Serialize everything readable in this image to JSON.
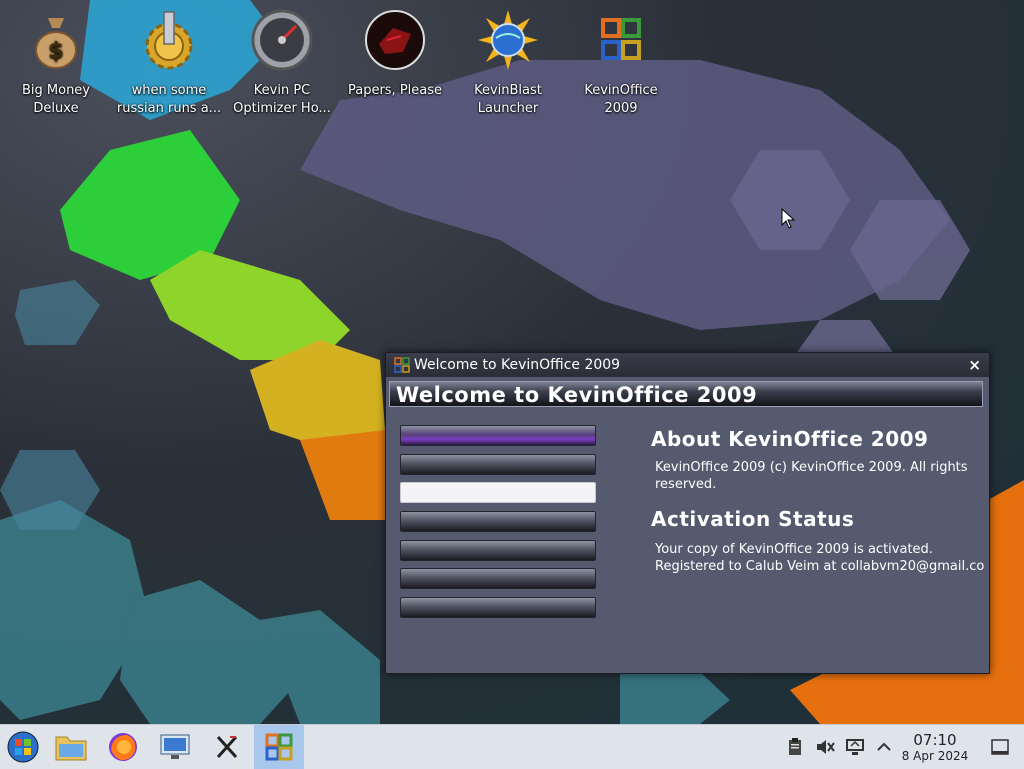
{
  "desktop": {
    "icons": [
      {
        "label": "Big Money\nDeluxe",
        "icon": "money-bag-icon"
      },
      {
        "label": "when some\nrussian runs a...",
        "icon": "gear-icon"
      },
      {
        "label": "Kevin PC\nOptimizer Ho...",
        "icon": "speedometer-icon"
      },
      {
        "label": "Papers, Please",
        "icon": "papers-please-icon"
      },
      {
        "label": "KevinBlast\nLauncher",
        "icon": "globe-sun-icon"
      },
      {
        "label": "KevinOffice\n2009",
        "icon": "office-logo-icon"
      }
    ]
  },
  "window": {
    "title": "Welcome to KevinOffice 2009",
    "close_label": "×",
    "banner": "Welcome to KevinOffice 2009",
    "nav_buttons": [
      "",
      "",
      "",
      "",
      "",
      "",
      ""
    ],
    "active_nav_index": 2,
    "about_heading": "About KevinOffice 2009",
    "about_text": "KevinOffice 2009 (c) KevinOffice 2009. All rights reserved.",
    "activation_heading": "Activation Status",
    "activation_line1": "Your copy of KevinOffice 2009 is activated.",
    "activation_line2": "Registered to Calub Veim at collabvm20@gmail.co"
  },
  "taskbar": {
    "clock_time": "07:10",
    "clock_date": "8 Apr 2024",
    "apps": [
      "start-orb-icon",
      "file-manager-icon",
      "firefox-icon",
      "remote-desktop-icon",
      "x-app-icon",
      "kevinoffice-taskbar-icon"
    ],
    "active_app_index": 5,
    "tray": [
      "clipboard-icon",
      "speaker-muted-icon",
      "network-monitor-icon",
      "chevron-up-icon",
      "show-desktop-icon"
    ]
  },
  "colors": {
    "window_bg": "#555a6e",
    "taskbar_bg": "#dfe3ea",
    "active_task": "#a9c6ec"
  }
}
